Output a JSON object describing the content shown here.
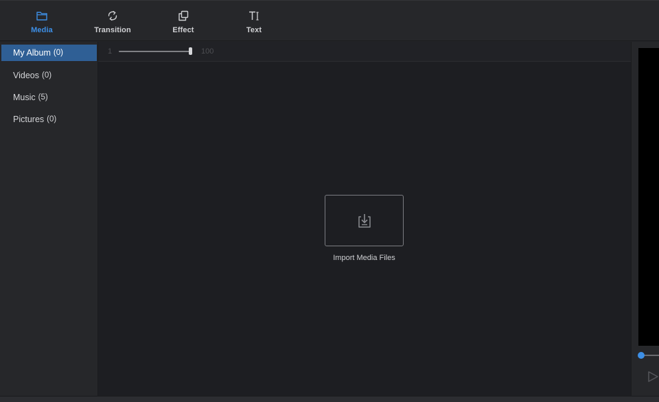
{
  "toolbar": {
    "tabs": [
      {
        "id": "media",
        "label": "Media",
        "icon": "folder-icon",
        "active": true
      },
      {
        "id": "transition",
        "label": "Transition",
        "icon": "transition-icon",
        "active": false
      },
      {
        "id": "effect",
        "label": "Effect",
        "icon": "effect-icon",
        "active": false
      },
      {
        "id": "text",
        "label": "Text",
        "icon": "text-icon",
        "active": false
      }
    ]
  },
  "sidebar": {
    "items": [
      {
        "label": "My Album",
        "count": "(0)",
        "active": true
      },
      {
        "label": "Videos",
        "count": "(0)",
        "active": false
      },
      {
        "label": "Music",
        "count": "(5)",
        "active": false
      },
      {
        "label": "Pictures",
        "count": "(0)",
        "active": false
      }
    ]
  },
  "library": {
    "zoom": {
      "min": "1",
      "max": "100",
      "value": 100
    },
    "import_label": "Import Media Files",
    "import_icon": "import-icon"
  },
  "preview": {
    "seek_icon": "seek-handle",
    "play_icon": "play-icon"
  },
  "colors": {
    "accent": "#3d8fe6",
    "active_item": "#2f5f95",
    "panel": "#26272a",
    "library_bg": "#1d1e22"
  }
}
